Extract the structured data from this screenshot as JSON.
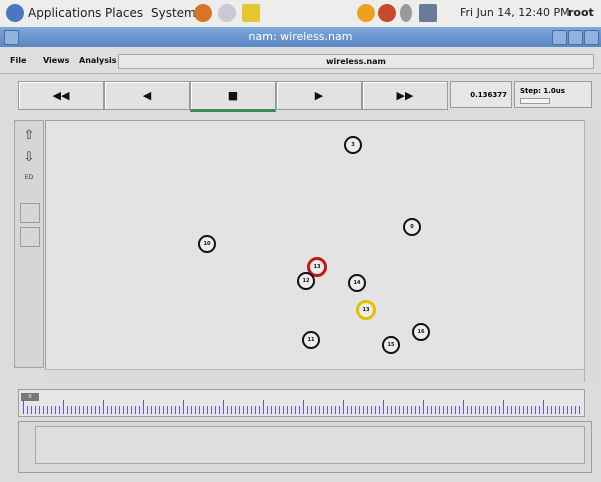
{
  "panel": {
    "menus": [
      "Applications",
      "Places",
      "System"
    ],
    "clock": "Fri Jun 14, 12:40 PM",
    "user": "root"
  },
  "window": {
    "title": "nam: wireless.nam"
  },
  "menubar": {
    "items": [
      "File",
      "Views",
      "Analysis"
    ],
    "filename": "wireless.nam"
  },
  "controls": {
    "rewind": "◀◀",
    "back": "◀",
    "stop": "■",
    "play": "▶",
    "fastforward": "▶▶",
    "time": "0.136377",
    "step": "Step: 1.0us"
  },
  "tools": {
    "zoom_in": "⇧",
    "zoom_out": "⇩",
    "edit": "ED"
  },
  "nodes": [
    {
      "label": "3"
    },
    {
      "label": "0"
    },
    {
      "label": "10"
    },
    {
      "label": "13"
    },
    {
      "label": "12"
    },
    {
      "label": "14"
    },
    {
      "label": "13"
    },
    {
      "label": "11"
    },
    {
      "label": "15"
    },
    {
      "label": "16"
    }
  ],
  "timeline": {
    "label": "0"
  },
  "colors": {
    "highlight_red": "#c21818",
    "highlight_yellow": "#e0c000",
    "titlebar": "#6a96cd",
    "play_indicator": "#3c8a4e"
  }
}
